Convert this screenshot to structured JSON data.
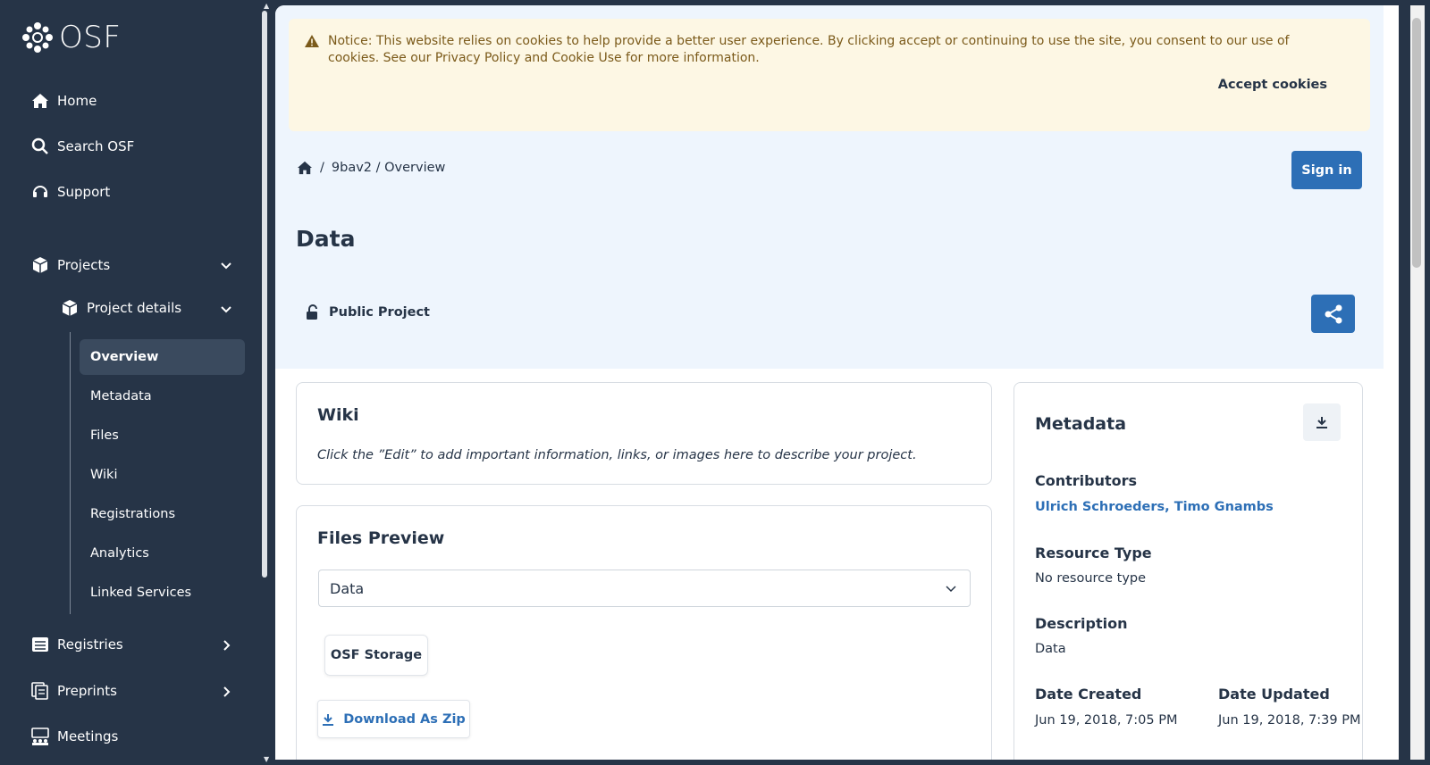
{
  "brand": {
    "name": "OSF"
  },
  "sidebar": {
    "home": "Home",
    "search": "Search OSF",
    "support": "Support",
    "projects": "Projects",
    "project_details": "Project details",
    "sub_items": [
      "Overview",
      "Metadata",
      "Files",
      "Wiki",
      "Registrations",
      "Analytics",
      "Linked Services"
    ],
    "registries": "Registries",
    "preprints": "Preprints",
    "meetings": "Meetings"
  },
  "cookie": {
    "notice": "Notice: This website relies on cookies to help provide a better user experience. By clicking accept or continuing to use the site, you consent to our use of cookies. See our Privacy Policy and Cookie Use for more information.",
    "accept": "Accept cookies"
  },
  "breadcrumb": {
    "sep": "/",
    "path": "9bav2 / Overview"
  },
  "header": {
    "sign_in": "Sign in",
    "title": "Data",
    "visibility": "Public Project"
  },
  "wiki": {
    "title": "Wiki",
    "text": "Click the ”Edit” to add important information, links, or images here to describe your project."
  },
  "files": {
    "title": "Files Preview",
    "selected": "Data",
    "storage": "OSF Storage",
    "download": "Download As Zip"
  },
  "metadata": {
    "title": "Metadata",
    "contributors_label": "Contributors",
    "contributors": "Ulrich Schroeders, Timo Gnambs",
    "resource_type_label": "Resource Type",
    "resource_type": "No resource type",
    "description_label": "Description",
    "description": "Data",
    "date_created_label": "Date Created",
    "date_created": "Jun 19, 2018, 7:05 PM",
    "date_updated_label": "Date Updated",
    "date_updated": "Jun 19, 2018, 7:39 PM"
  },
  "colors": {
    "sidebar": "#263447",
    "primary": "#2d6fb6",
    "hero": "#eef5fd",
    "notice": "#fdf7e4"
  }
}
